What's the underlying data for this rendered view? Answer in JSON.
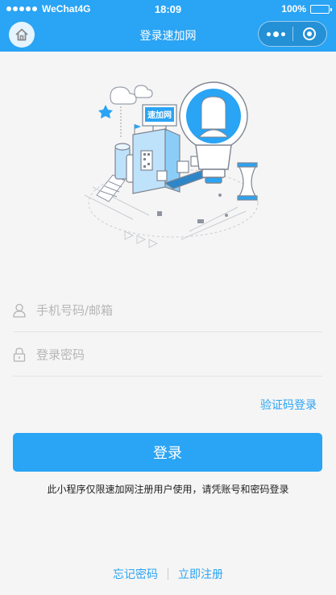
{
  "status_bar": {
    "carrier": "WeChat4G",
    "time": "18:09",
    "battery": "100%",
    "signal_icon": "signal-dots-icon",
    "battery_icon": "battery-icon"
  },
  "nav": {
    "title": "登录速加网",
    "home_icon": "home-icon",
    "more_icon": "more-dots-icon",
    "close_icon": "close-circle-icon"
  },
  "hero": {
    "sign_text": "速加网",
    "image_icon": "factory-lightbulb-illustration"
  },
  "form": {
    "account_placeholder": "手机号码/邮箱",
    "account_value": "",
    "account_icon": "user-icon",
    "password_placeholder": "登录密码",
    "password_value": "",
    "password_icon": "lock-icon",
    "code_login_label": "验证码登录",
    "login_button": "登录",
    "notice": "此小程序仅限速加网注册用户使用，请凭账号和密码登录"
  },
  "footer": {
    "forgot_password": "忘记密码",
    "register": "立即注册"
  },
  "colors": {
    "primary": "#2aa4f4",
    "background": "#f5f5f5",
    "placeholder": "#b6b6b6"
  }
}
